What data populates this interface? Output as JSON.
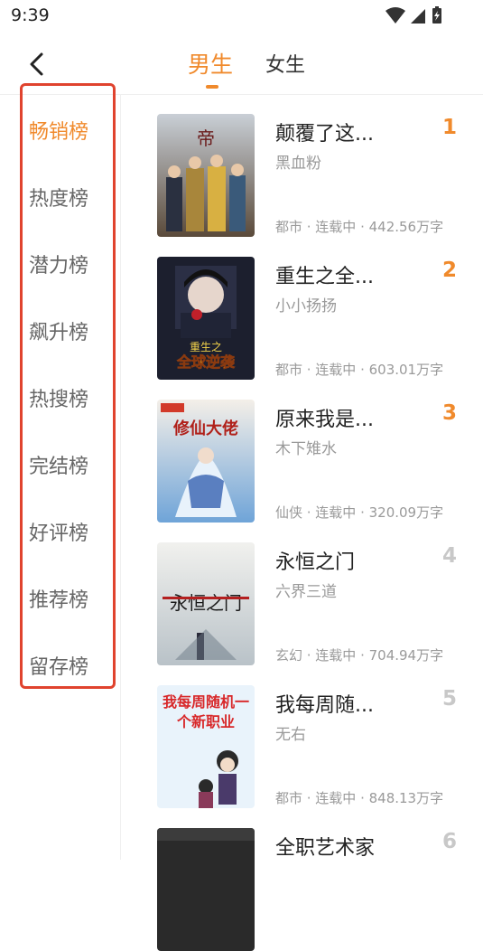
{
  "status_bar": {
    "time": "9:39"
  },
  "header": {
    "tabs": [
      {
        "label": "男生",
        "active": true
      },
      {
        "label": "女生",
        "active": false
      }
    ],
    "accent_color": "#f08a2c"
  },
  "sidebar": {
    "items": [
      {
        "label": "畅销榜",
        "active": true
      },
      {
        "label": "热度榜"
      },
      {
        "label": "潜力榜"
      },
      {
        "label": "飙升榜"
      },
      {
        "label": "热搜榜"
      },
      {
        "label": "完结榜"
      },
      {
        "label": "好评榜"
      },
      {
        "label": "推荐榜"
      },
      {
        "label": "留存榜"
      }
    ]
  },
  "books": [
    {
      "rank": "1",
      "title": "颠覆了这...",
      "author": "黑血粉",
      "meta": "都市 · 连载中 · 442.56万字",
      "cover_text": ""
    },
    {
      "rank": "2",
      "title": "重生之全...",
      "author": "小小扬扬",
      "meta": "都市 · 连载中 · 603.01万字",
      "cover_text": "全球逆袭"
    },
    {
      "rank": "3",
      "title": "原来我是...",
      "author": "木下雉水",
      "meta": "仙侠 · 连载中 · 320.09万字",
      "cover_text": "修仙大佬"
    },
    {
      "rank": "4",
      "title": "永恒之门",
      "author": "六界三道",
      "meta": "玄幻 · 连载中 · 704.94万字",
      "cover_text": "永恒之门"
    },
    {
      "rank": "5",
      "title": "我每周随...",
      "author": "无右",
      "meta": "都市 · 连载中 · 848.13万字",
      "cover_text": "我每周随机一个新职业"
    },
    {
      "rank": "6",
      "title": "全职艺术家",
      "author": "",
      "meta": "",
      "cover_text": ""
    }
  ]
}
